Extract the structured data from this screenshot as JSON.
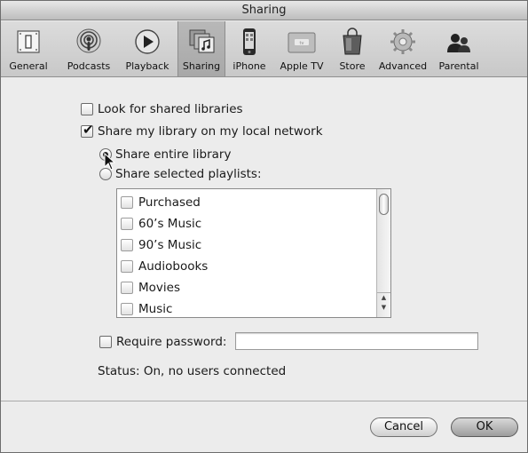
{
  "window": {
    "title": "Sharing"
  },
  "toolbar": {
    "items": [
      {
        "label": "General",
        "icon": "general-switch-icon"
      },
      {
        "label": "Podcasts",
        "icon": "podcasts-icon"
      },
      {
        "label": "Playback",
        "icon": "playback-icon"
      },
      {
        "label": "Sharing",
        "icon": "sharing-icon",
        "selected": true
      },
      {
        "label": "iPhone",
        "icon": "iphone-icon"
      },
      {
        "label": "Apple TV",
        "icon": "apple-tv-icon"
      },
      {
        "label": "Store",
        "icon": "store-bag-icon"
      },
      {
        "label": "Advanced",
        "icon": "advanced-gear-icon"
      },
      {
        "label": "Parental",
        "icon": "parental-icon"
      }
    ]
  },
  "options": {
    "look_for_shared": {
      "label": "Look for shared libraries",
      "checked": false
    },
    "share_library": {
      "label": "Share my library on my local network",
      "checked": true
    },
    "share_entire": {
      "label": "Share entire library",
      "selected": true
    },
    "share_selected": {
      "label": "Share selected playlists:",
      "selected": false
    }
  },
  "playlists": [
    {
      "label": "Purchased",
      "checked": false
    },
    {
      "label": "60’s Music",
      "checked": false
    },
    {
      "label": "90’s Music",
      "checked": false
    },
    {
      "label": "Audiobooks",
      "checked": false
    },
    {
      "label": "Movies",
      "checked": false
    },
    {
      "label": "Music",
      "checked": false
    }
  ],
  "password": {
    "label": "Require password:",
    "checked": false,
    "value": ""
  },
  "status": {
    "text": "Status: On, no users connected"
  },
  "buttons": {
    "cancel": "Cancel",
    "ok": "OK"
  }
}
